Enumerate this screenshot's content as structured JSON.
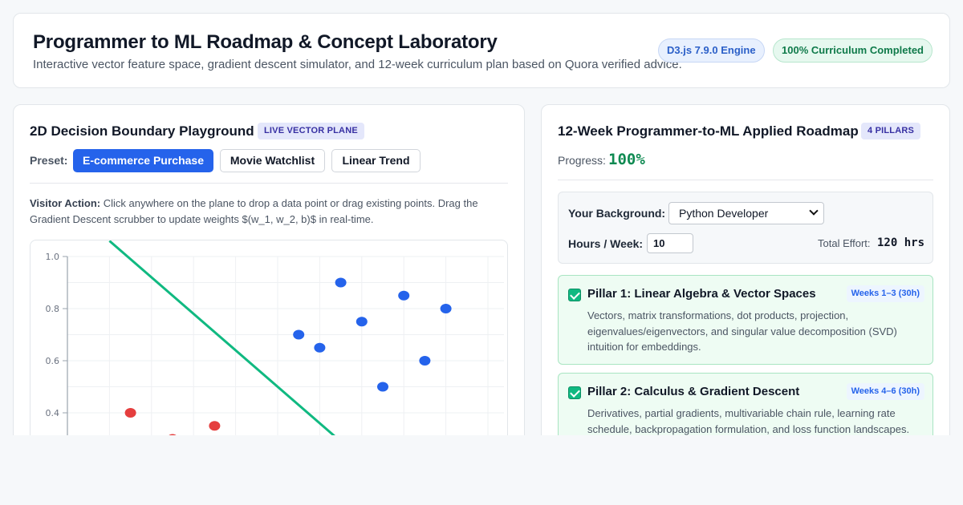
{
  "header": {
    "title": "Programmer to ML Roadmap & Concept Laboratory",
    "subtitle": "Interactive vector feature space, gradient descent simulator, and 12-week curriculum plan based on Quora verified advice.",
    "badge_engine": "D3.js 7.9.0 Engine",
    "badge_completed": "100% Curriculum Completed"
  },
  "playground": {
    "title": "2D Decision Boundary Playground",
    "tag": "LIVE VECTOR PLANE",
    "preset_label": "Preset:",
    "presets": [
      "E-commerce Purchase",
      "Movie Watchlist",
      "Linear Trend"
    ],
    "active_preset": "E-commerce Purchase",
    "instruction_bold": "Visitor Action:",
    "instruction_text": " Click anywhere on the plane to drop a data point or drag existing points. Drag the Gradient Descent scrubber to update weights $(w_1, w_2, b)$ in real-time."
  },
  "chart_data": {
    "type": "scatter",
    "title": "",
    "xlabel": "",
    "ylabel": "",
    "xlim": [
      0,
      1
    ],
    "ylim": [
      0,
      1
    ],
    "y_tick_labels": [
      "1.0",
      "0.8",
      "0.6",
      "0.4"
    ],
    "grid": true,
    "series": [
      {
        "color": "#2563eb",
        "points": [
          [
            0.65,
            0.9
          ],
          [
            0.8,
            0.85
          ],
          [
            0.9,
            0.8
          ],
          [
            0.7,
            0.75
          ],
          [
            0.55,
            0.7
          ],
          [
            0.6,
            0.65
          ],
          [
            0.85,
            0.6
          ],
          [
            0.75,
            0.5
          ]
        ]
      },
      {
        "color": "#e53e3e",
        "points": [
          [
            0.15,
            0.4
          ],
          [
            0.35,
            0.35
          ],
          [
            0.25,
            0.3
          ]
        ]
      }
    ],
    "boundary": {
      "color": "#10b981",
      "points": [
        [
          0.1,
          1.06
        ],
        [
          0.65,
          0.29
        ]
      ]
    }
  },
  "roadmap": {
    "title": "12-Week Programmer-to-ML Applied Roadmap",
    "tag": "4 PILLARS",
    "progress_label": "Progress:",
    "progress_value": "100%",
    "background_label": "Your Background:",
    "background_value": "Python Developer",
    "hours_label": "Hours / Week:",
    "hours_value": "10",
    "effort_label": "Total Effort:",
    "effort_value": "120 hrs",
    "pillars": [
      {
        "title": "Pillar 1: Linear Algebra & Vector Spaces",
        "weeks": "Weeks 1–3 (30h)",
        "description": "Vectors, matrix transformations, dot products, projection, eigenvalues/eigenvectors, and singular value decomposition (SVD) intuition for embeddings.",
        "checked": true
      },
      {
        "title": "Pillar 2: Calculus & Gradient Descent",
        "weeks": "Weeks 4–6 (30h)",
        "description": "Derivatives, partial gradients, multivariable chain rule, learning rate schedule, backpropagation formulation, and loss function landscapes.",
        "checked": true
      }
    ]
  },
  "colors": {
    "accent": "#2563eb",
    "success": "#10b981",
    "danger": "#e53e3e"
  }
}
